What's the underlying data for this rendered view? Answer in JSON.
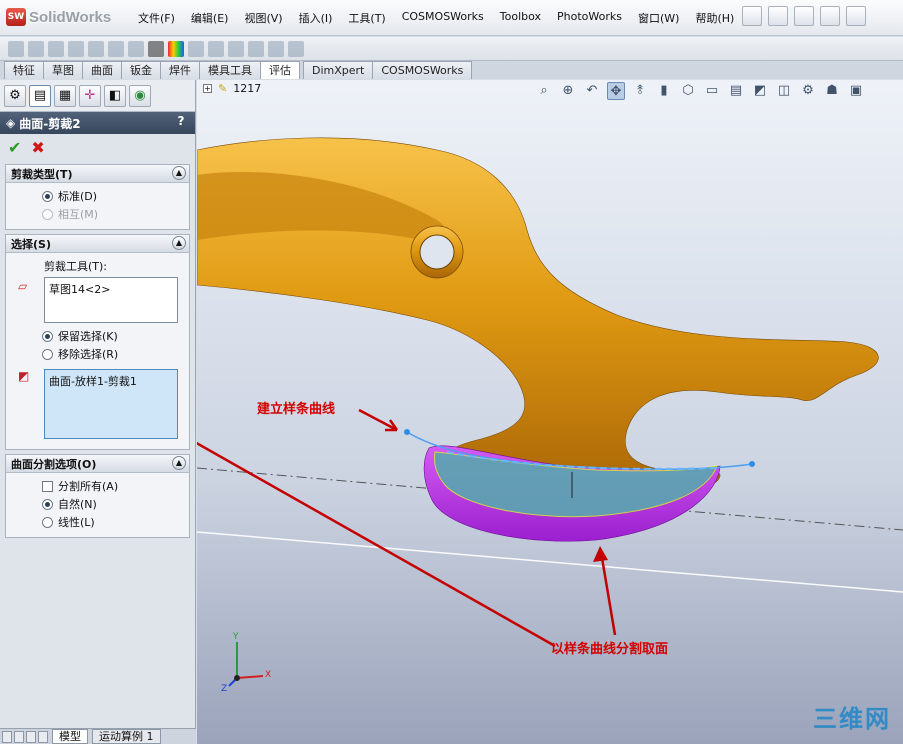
{
  "app": {
    "logo_text": "SolidWorks",
    "logo_badge": "SW"
  },
  "menu": [
    "文件(F)",
    "编辑(E)",
    "视图(V)",
    "插入(I)",
    "工具(T)",
    "COSMOSWorks",
    "Toolbox",
    "PhotoWorks",
    "窗口(W)",
    "帮助(H)"
  ],
  "cm_tabs": [
    "特征",
    "草图",
    "曲面",
    "钣金",
    "焊件",
    "模具工具",
    "评估",
    "DimXpert",
    "COSMOSWorks"
  ],
  "cm_active_tab": "评估",
  "tree": {
    "count_label": "1217"
  },
  "feature": {
    "title": "曲面-剪裁2",
    "help": "?"
  },
  "trim_type": {
    "header": "剪裁类型(T)",
    "options": [
      {
        "label": "标准(D)",
        "selected": true,
        "enabled": true
      },
      {
        "label": "相互(M)",
        "selected": false,
        "enabled": false
      }
    ]
  },
  "selection": {
    "header": "选择(S)",
    "trim_tool_label": "剪裁工具(T):",
    "trim_tool_value": "草图14<2>",
    "keep_remove": [
      {
        "label": "保留选择(K)",
        "selected": true
      },
      {
        "label": "移除选择(R)",
        "selected": false
      }
    ],
    "selected_faces": "曲面-放样1-剪裁1"
  },
  "split_options": {
    "header": "曲面分割选项(O)",
    "split_all": {
      "label": "分割所有(A)",
      "checked": false
    },
    "options": [
      {
        "label": "自然(N)",
        "selected": true
      },
      {
        "label": "线性(L)",
        "selected": false
      }
    ]
  },
  "annotations": {
    "spline": "建立样条曲线",
    "split": "以样条曲线分割取面"
  },
  "triad": {
    "x": "X",
    "y": "Y",
    "z": "Z"
  },
  "bottom_tabs": [
    "模型",
    "运动算例 1"
  ],
  "watermark": "三维网",
  "colors": {
    "part_gold": "#e8a318",
    "trim_magenta": "#c43ee6",
    "arrow_red": "#c40000",
    "spline_blue": "#4b9ef0"
  }
}
